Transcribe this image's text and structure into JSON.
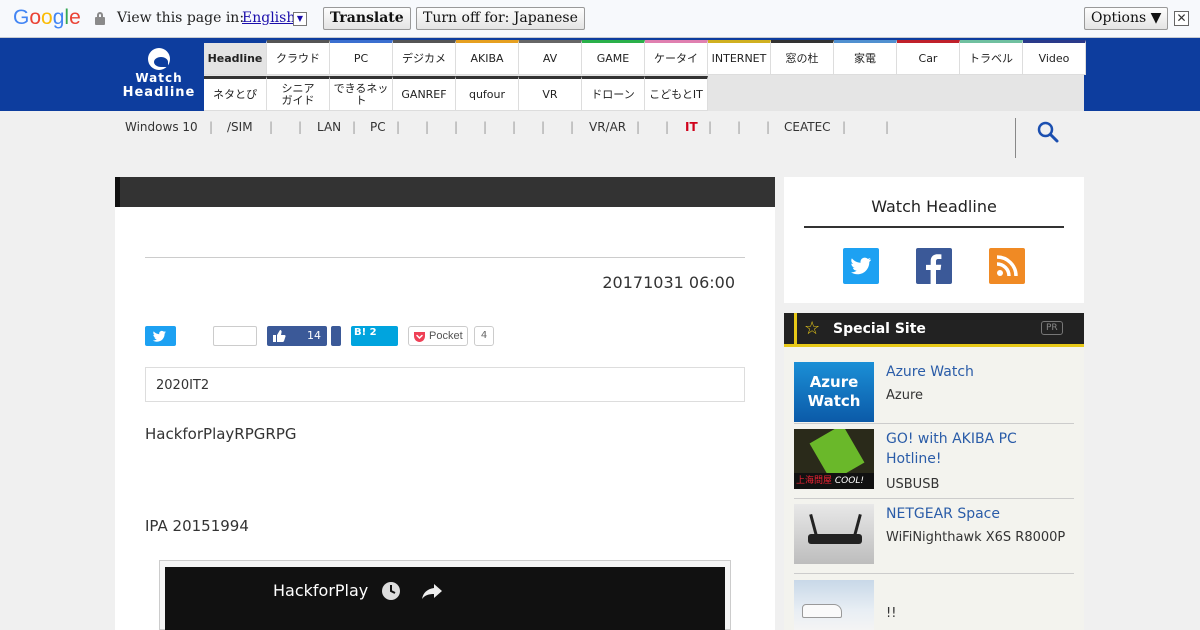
{
  "translate_bar": {
    "logo": "Google",
    "prompt": "View this page in:",
    "language": "English",
    "translate_label": "Translate",
    "turn_off_label": "Turn off for: Japanese",
    "options_label": "Options ▼",
    "close_label": "✕"
  },
  "site": {
    "logo_line1": "Watch",
    "logo_line2": "Headline"
  },
  "nav": {
    "row1": [
      "Headline",
      "クラウド",
      "PC",
      "デジカメ",
      "AKIBA",
      "AV",
      "GAME",
      "ケータイ",
      "INTERNET",
      "窓の杜",
      "家電",
      "Car",
      "トラベル",
      "Video"
    ],
    "row1_colors": [
      "#0d3d9e",
      "#555555",
      "#3b6fd0",
      "#555555",
      "#e6a020",
      "#666666",
      "#2ab04a",
      "#e080b0",
      "#d0b020",
      "#333333",
      "#5090d0",
      "#c0202a",
      "#70c0a0",
      "#2a3a8a"
    ],
    "row2": [
      "ネタとぴ",
      "シニア\nガイド",
      "できるネット",
      "GANREF",
      "qufour",
      "VR",
      "ドローン",
      "こどもとIT"
    ],
    "active": "Headline"
  },
  "subnav": {
    "items": [
      "Windows 10",
      "/SIM",
      "LAN",
      "PC",
      "VR/AR",
      "IT",
      "CEATEC"
    ],
    "highlight": "IT"
  },
  "article": {
    "date": "20171031 06:00",
    "fb_count": "14",
    "hatena_label": "B! 2",
    "pocket_label": "Pocket",
    "pocket_count": "4",
    "lead": "2020IT2",
    "para1": "HackforPlayRPGRPG",
    "para2": "IPA 20151994",
    "video_title": "HackforPlay"
  },
  "sidebar": {
    "social_title": "Watch Headline",
    "special_title": "Special Site",
    "pr_badge": "PR",
    "items": [
      {
        "name": "Azure Watch",
        "desc": "Azure",
        "thumb_label1": "Azure",
        "thumb_label2": "Watch"
      },
      {
        "name": "GO! with AKIBA PC Hotline!",
        "desc": "USBUSB",
        "thumb_label1": "上海問屋",
        "thumb_label2": "COOL!"
      },
      {
        "name": "NETGEAR Space",
        "desc": "WiFiNighthawk X6S R8000P"
      },
      {
        "name": "",
        "desc": "!!"
      }
    ]
  },
  "colors": {
    "brand_blue": "#0d3d9e",
    "accent_yellow": "#e8c918",
    "link_blue": "#2a5ca8",
    "highlight_red": "#d0021b"
  }
}
